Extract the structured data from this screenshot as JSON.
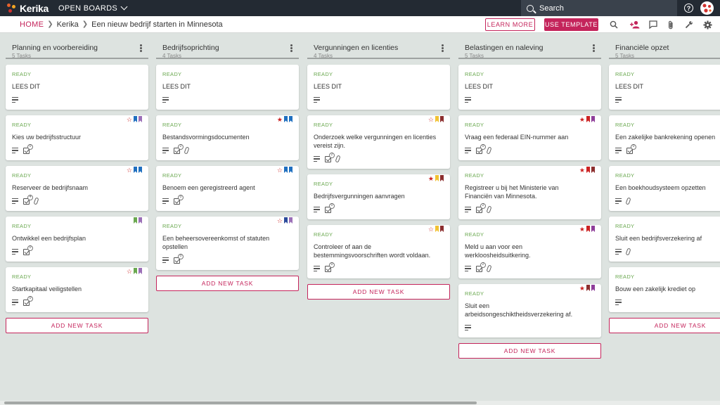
{
  "app": {
    "logo_text": "Kerika",
    "open_boards": "OPEN BOARDS",
    "search_placeholder": "Search"
  },
  "breadcrumb": {
    "home": "HOME",
    "items": [
      "Kerika",
      "Een nieuw bedrijf starten in Minnesota"
    ]
  },
  "toolbar": {
    "learn_more": "LEARN MORE",
    "use_template": "USE TEMPLATE",
    "icons": [
      "search-icon",
      "add-person-icon",
      "chat-icon",
      "attachment-icon",
      "wrench-icon",
      "gear-icon"
    ]
  },
  "colors": {
    "accent": "#c4245b",
    "ready": "#6aa84f",
    "topbar": "#232a33",
    "board_bg": "#dde3e0",
    "flag_blue": "#1f6fbf",
    "flag_purple": "#9b6fb7",
    "flag_green": "#6aa84f",
    "flag_yellow": "#f1c232",
    "flag_red": "#cc2222",
    "flag_brown": "#8c2e2e",
    "flag_magenta": "#8e3d99",
    "flag_darkblue": "#2b4a9b"
  },
  "add_task_label": "ADD NEW TASK",
  "columns": [
    {
      "title": "Planning en voorbereiding",
      "count": "5 Tasks",
      "cards": [
        {
          "status": "READY",
          "title": "LEES DIT",
          "icons": [
            "desc"
          ],
          "flags": []
        },
        {
          "status": "READY",
          "title": "Kies uw bedrijfsstructuur",
          "icons": [
            "desc",
            "check:0"
          ],
          "star": "outline",
          "flags": [
            "#1f6fbf",
            "#9b6fb7"
          ]
        },
        {
          "status": "READY",
          "title": "Reserveer de bedrijfsnaam",
          "icons": [
            "desc",
            "check:4",
            "clip"
          ],
          "star": "outline",
          "flags": [
            "#1f6fbf",
            "#1f6fbf"
          ]
        },
        {
          "status": "READY",
          "title": "Ontwikkel een bedrijfsplan",
          "icons": [
            "desc",
            "check:0"
          ],
          "flags": [
            "#6aa84f",
            "#9b6fb7"
          ]
        },
        {
          "status": "READY",
          "title": "Startkapitaal veiligstellen",
          "icons": [
            "desc",
            "check:0"
          ],
          "star": "outline",
          "flags": [
            "#6aa84f",
            "#9b6fb7"
          ]
        }
      ]
    },
    {
      "title": "Bedrijfsoprichting",
      "count": "4 Tasks",
      "cards": [
        {
          "status": "READY",
          "title": "LEES DIT",
          "icons": [
            "desc"
          ],
          "flags": []
        },
        {
          "status": "READY",
          "title": "Bestandsvormingsdocumenten",
          "icons": [
            "desc",
            "check:2",
            "clip"
          ],
          "star": "filled",
          "flags": [
            "#1f6fbf",
            "#1f6fbf"
          ]
        },
        {
          "status": "READY",
          "title": "Benoem een geregistreerd agent",
          "icons": [
            "desc",
            "check:0"
          ],
          "star": "outline",
          "flags": [
            "#1f6fbf",
            "#1f6fbf"
          ]
        },
        {
          "status": "READY",
          "title": "Een beheersovereenkomst of statuten opstellen",
          "icons": [
            "desc",
            "check:0"
          ],
          "star": "outline",
          "flags": [
            "#2b4a9b",
            "#9b6fb7"
          ]
        }
      ]
    },
    {
      "title": "Vergunningen en licenties",
      "count": "4 Tasks",
      "cards": [
        {
          "status": "READY",
          "title": "LEES DIT",
          "icons": [
            "desc"
          ],
          "flags": []
        },
        {
          "status": "READY",
          "title": "Onderzoek welke vergunningen en licenties vereist zijn.",
          "icons": [
            "desc",
            "check:2",
            "clip"
          ],
          "star": "outline",
          "flags": [
            "#f1c232",
            "#8c2e2e"
          ]
        },
        {
          "status": "READY",
          "title": "Bedrijfsvergunningen aanvragen",
          "icons": [
            "desc",
            "check:0"
          ],
          "star": "filled",
          "flags": [
            "#f1c232",
            "#8c2e2e"
          ]
        },
        {
          "status": "READY",
          "title": "Controleer of aan de bestemmingsvoorschriften wordt voldaan.",
          "icons": [
            "desc",
            "check:0"
          ],
          "star": "outline",
          "flags": [
            "#f1c232",
            "#8c2e2e"
          ]
        }
      ]
    },
    {
      "title": "Belastingen en naleving",
      "count": "5 Tasks",
      "cards": [
        {
          "status": "READY",
          "title": "LEES DIT",
          "icons": [
            "desc"
          ],
          "flags": []
        },
        {
          "status": "READY",
          "title": "Vraag een federaal EIN-nummer aan",
          "icons": [
            "desc",
            "check:0",
            "clip"
          ],
          "star": "filled",
          "flags": [
            "#cc2222",
            "#8e3d99"
          ]
        },
        {
          "status": "READY",
          "title": "Registreer u bij het Ministerie van Financiën van Minnesota.",
          "icons": [
            "desc",
            "check:2",
            "clip"
          ],
          "star": "filled",
          "flags": [
            "#cc2222",
            "#8c2e2e"
          ]
        },
        {
          "status": "READY",
          "title": "Meld u aan voor een werkloosheidsuitkering.",
          "icons": [
            "desc",
            "check:2",
            "clip"
          ],
          "star": "filled",
          "flags": [
            "#cc2222",
            "#8e3d99"
          ]
        },
        {
          "status": "READY",
          "title": "Sluit een arbeidsongeschiktheidsverzekering af.",
          "icons": [
            "desc"
          ],
          "star": "filled",
          "flags": [
            "#8c2e2e",
            "#8e3d99"
          ]
        }
      ]
    },
    {
      "title": "Financiële opzet",
      "count": "5 Tasks",
      "cards": [
        {
          "status": "READY",
          "title": "LEES DIT",
          "icons": [
            "desc"
          ],
          "flags": []
        },
        {
          "status": "READY",
          "title": "Een zakelijke bankrekening openen",
          "icons": [
            "desc",
            "check:0"
          ],
          "flags": []
        },
        {
          "status": "READY",
          "title": "Een boekhoudsysteem opzetten",
          "icons": [
            "desc",
            "clip"
          ],
          "flags": []
        },
        {
          "status": "READY",
          "title": "Sluit een bedrijfsverzekering af",
          "icons": [
            "desc",
            "clip"
          ],
          "flags": []
        },
        {
          "status": "READY",
          "title": "Bouw een zakelijk krediet op",
          "icons": [
            "desc"
          ],
          "flags": []
        }
      ]
    }
  ]
}
